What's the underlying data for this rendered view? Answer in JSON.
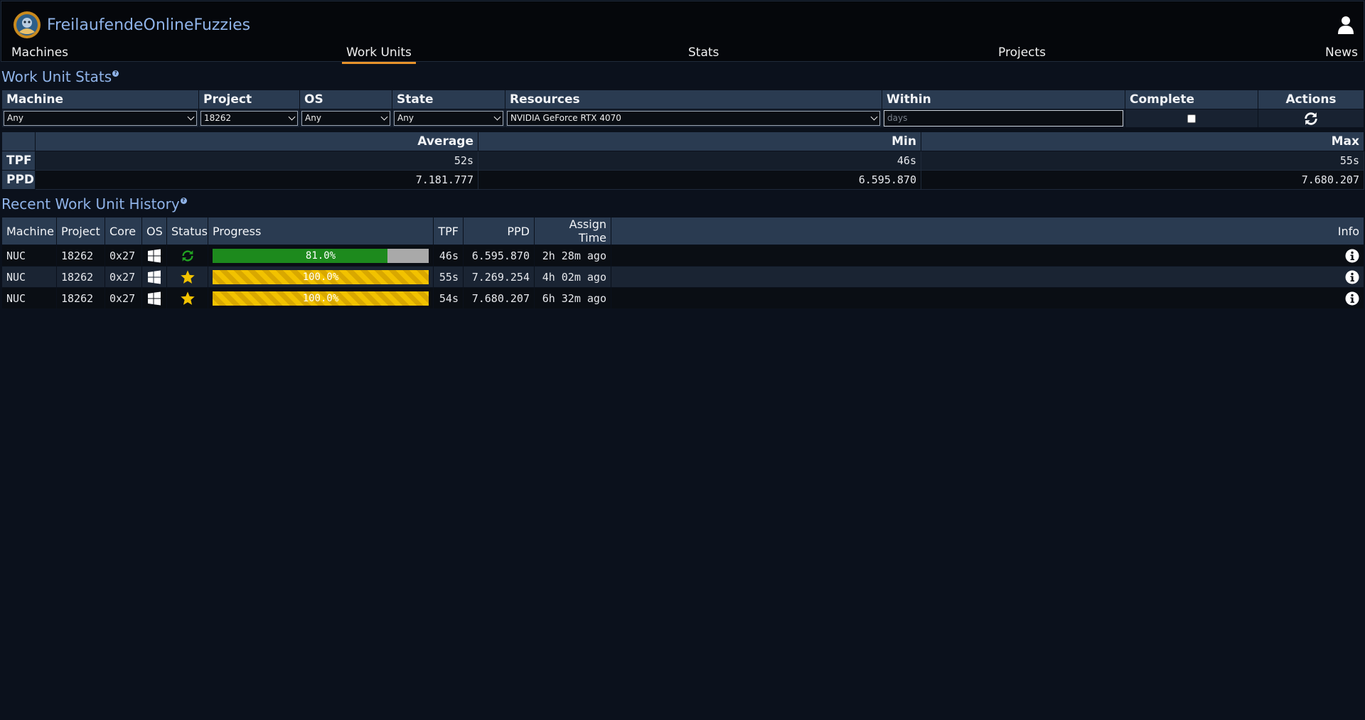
{
  "brand": {
    "name": "FreilaufendeOnlineFuzzies",
    "logo_icon": "fah-logo-icon",
    "user_icon": "user-icon"
  },
  "nav": {
    "items": [
      {
        "label": "Machines",
        "active": false
      },
      {
        "label": "Work Units",
        "active": true
      },
      {
        "label": "Stats",
        "active": false
      },
      {
        "label": "Projects",
        "active": false
      },
      {
        "label": "News",
        "active": false
      }
    ],
    "accent_color": "#e8932b"
  },
  "stats_section": {
    "title": "Work Unit Stats",
    "help_icon": "help-icon",
    "filter_headers": [
      "Machine",
      "Project",
      "OS",
      "State",
      "Resources",
      "Within",
      "Complete",
      "Actions"
    ],
    "filters": {
      "machine": "Any",
      "project": "18262",
      "os": "Any",
      "state": "Any",
      "resources": "NVIDIA GeForce RTX 4070",
      "within_placeholder": "days",
      "complete_checked": false,
      "refresh_icon": "refresh-icon"
    },
    "summary_headers": [
      "",
      "Average",
      "Min",
      "Max"
    ],
    "summary_rows": [
      {
        "label": "TPF",
        "average": "52s",
        "min": "46s",
        "max": "55s"
      },
      {
        "label": "PPD",
        "average": "7.181.777",
        "min": "6.595.870",
        "max": "7.680.207"
      }
    ]
  },
  "history_section": {
    "title": "Recent Work Unit History",
    "help_icon": "help-icon",
    "headers": [
      "Machine",
      "Project",
      "Core",
      "OS",
      "Status",
      "Progress",
      "TPF",
      "PPD",
      "Assign Time",
      "Info"
    ],
    "rows": [
      {
        "machine": "NUC",
        "project": "18262",
        "core": "0x27",
        "os_icon": "windows-icon",
        "status_icon": "running-refresh-icon",
        "progress": 0.81,
        "progress_label": "81.0%",
        "progress_state": "running",
        "tpf": "46s",
        "ppd": "6.595.870",
        "assign_time": "2h 28m ago",
        "info_icon": "info-icon"
      },
      {
        "machine": "NUC",
        "project": "18262",
        "core": "0x27",
        "os_icon": "windows-icon",
        "status_icon": "star-icon",
        "progress": 1.0,
        "progress_label": "100.0%",
        "progress_state": "done",
        "tpf": "55s",
        "ppd": "7.269.254",
        "assign_time": "4h 02m ago",
        "info_icon": "info-icon"
      },
      {
        "machine": "NUC",
        "project": "18262",
        "core": "0x27",
        "os_icon": "windows-icon",
        "status_icon": "star-icon",
        "progress": 1.0,
        "progress_label": "100.0%",
        "progress_state": "done",
        "tpf": "54s",
        "ppd": "7.680.207",
        "assign_time": "6h 32m ago",
        "info_icon": "info-icon"
      }
    ],
    "colors": {
      "running": "#1d8a1d",
      "done": "#f2c200",
      "star": "#f2c200",
      "running_icon": "#22a322"
    }
  }
}
